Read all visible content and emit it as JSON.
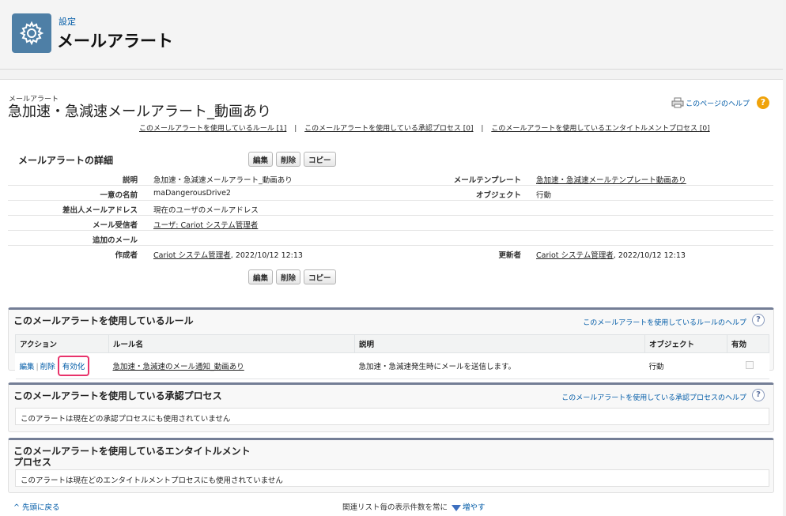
{
  "header": {
    "sub": "設定",
    "title": "メールアラート",
    "icon": "gear-icon"
  },
  "record": {
    "entity_type": "メールアラート",
    "name": "急加速・急減速メールアラート_動画あり",
    "help_link": "このページのヘルプ"
  },
  "related_links": [
    {
      "label": "このメールアラートを使用しているルール",
      "count": "[1]"
    },
    {
      "label": "このメールアラートを使用している承認プロセス",
      "count": "[0]"
    },
    {
      "label": "このメールアラートを使用しているエンタイトルメントプロセス",
      "count": "[0]"
    }
  ],
  "detail": {
    "title": "メールアラートの詳細",
    "buttons": {
      "edit": "編集",
      "delete": "削除",
      "copy": "コピー"
    },
    "fields": {
      "description_label": "説明",
      "description_value": "急加速・急減速メールアラート_動画あり",
      "template_label": "メールテンプレート",
      "template_value": "急加速・急減速メールテンプレート動画あり",
      "unique_name_label": "一意の名前",
      "unique_name_value": "maDangerousDrive2",
      "object_label": "オブジェクト",
      "object_value": "行動",
      "from_label": "差出人メールアドレス",
      "from_value": "現在のユーザのメールアドレス",
      "recipient_label": "メール受信者",
      "recipient_value": "ユーザ: Cariot システム管理者",
      "additional_label": "追加のメール",
      "additional_value": "",
      "created_label": "作成者",
      "created_by": "Cariot システム管理者",
      "created_date": ", 2022/10/12 12:13",
      "modified_label": "更新者",
      "modified_by": "Cariot システム管理者",
      "modified_date": ", 2022/10/12 12:13"
    }
  },
  "rules_section": {
    "title": "このメールアラートを使用しているルール",
    "help": "このメールアラートを使用しているルールのヘルプ",
    "help_q": "?",
    "columns": [
      "アクション",
      "ルール名",
      "説明",
      "オブジェクト",
      "有効"
    ],
    "row": {
      "edit": "編集",
      "delete": "削除",
      "activate": "有効化",
      "sep": "|",
      "rule_name": "急加速・急減速のメール通知_動画あり",
      "description": "急加速・急減速発生時にメールを送信します。",
      "object": "行動"
    }
  },
  "approval_section": {
    "title": "このメールアラートを使用している承認プロセス",
    "help": "このメールアラートを使用している承認プロセスのヘルプ",
    "help_q": "?",
    "empty": "このアラートは現在どの承認プロセスにも使用されていません"
  },
  "entitlement_section": {
    "title_line1": "このメールアラートを使用しているエンタイトルメント",
    "title_line2": "プロセス",
    "empty": "このアラートは現在どのエンタイトルメントプロセスにも使用されていません"
  },
  "footer": {
    "back": "^ 先頭に戻る",
    "show_text": "関連リスト毎の表示件数を常に",
    "increase": "増やす"
  },
  "colors": {
    "accent": "#015ba7",
    "highlight": "#e8336b",
    "section_border": "#747e96"
  }
}
